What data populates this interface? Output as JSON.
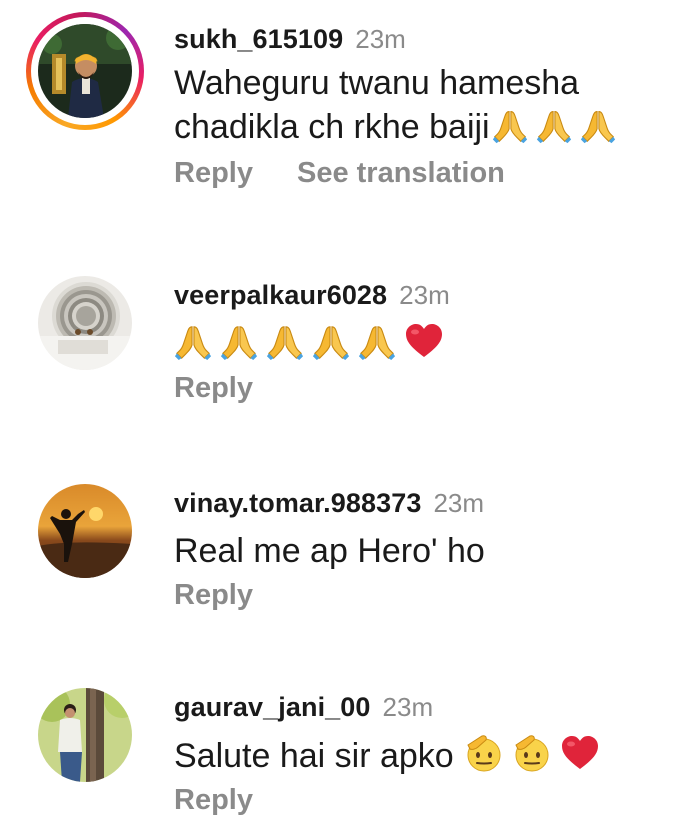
{
  "comments": [
    {
      "username": "sukh_615109",
      "time": "23m",
      "text_line1": "Waheguru twanu hamesha",
      "text_line2": "chadikla ch rkhe baiji",
      "emojis": [
        "folded-hands",
        "folded-hands",
        "folded-hands"
      ],
      "reply_label": "Reply",
      "translate_label": "See translation",
      "has_story_ring": true
    },
    {
      "username": "veerpalkaur6028",
      "time": "23m",
      "emojis": [
        "folded-hands",
        "folded-hands",
        "folded-hands",
        "folded-hands",
        "folded-hands",
        "red-heart"
      ],
      "reply_label": "Reply"
    },
    {
      "username": "vinay.tomar.988373",
      "time": "23m",
      "text": "Real me ap Hero' ho",
      "reply_label": "Reply"
    },
    {
      "username": "gaurav_jani_00",
      "time": "23m",
      "text": "Salute hai sir apko",
      "emojis": [
        "saluting-face",
        "saluting-face",
        "red-heart"
      ],
      "reply_label": "Reply"
    }
  ],
  "colors": {
    "text": "#1a1a1a",
    "muted": "#8a8a8a",
    "heart": "#e0243a",
    "hands": "#f6b832"
  }
}
